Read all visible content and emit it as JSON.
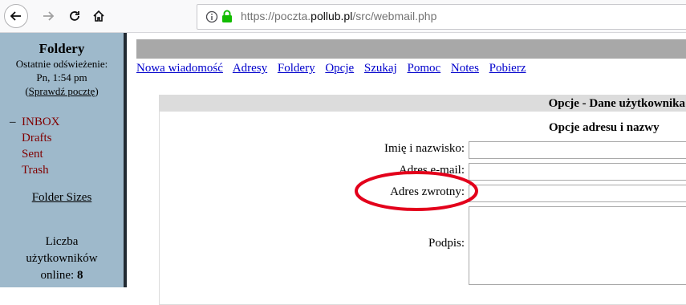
{
  "browser": {
    "url_prefix": "https://poczta.",
    "url_host": "pollub.pl",
    "url_path": "/src/webmail.php",
    "icons": {
      "back": "back-arrow-icon",
      "forward": "forward-arrow-icon",
      "reload": "reload-icon",
      "home": "home-icon",
      "info": "info-icon",
      "lock": "lock-icon"
    },
    "lock_color": "#12bc00"
  },
  "sidebar": {
    "title": "Foldery",
    "refresh_label": "Ostatnie odświeżenie:",
    "refresh_time": "Pn, 1:54 pm",
    "check_mail_open": "(",
    "check_mail": "Sprawdź pocztę",
    "check_mail_close": ")",
    "folders": [
      {
        "label": "INBOX",
        "current": true
      },
      {
        "label": "Drafts",
        "current": false
      },
      {
        "label": "Sent",
        "current": false
      },
      {
        "label": "Trash",
        "current": false
      }
    ],
    "current_marker": "–",
    "folder_sizes": "Folder Sizes",
    "online_line1": "Liczba",
    "online_line2": "użytkowników",
    "online_line3": "online:",
    "online_count": "8",
    "background_color": "#9eb9cb",
    "folder_link_color": "#800000"
  },
  "menu": [
    "Nowa wiadomość",
    "Adresy",
    "Foldery",
    "Opcje",
    "Szukaj",
    "Pomoc",
    "Notes",
    "Pobierz"
  ],
  "options": {
    "header": "Opcje - Dane użytkownika",
    "section_title": "Opcje adresu i nazwy",
    "fields": {
      "full_name": {
        "label": "Imię i nazwisko:",
        "value": ""
      },
      "email": {
        "label": "Adres e-mail:",
        "value": ""
      },
      "reply_to": {
        "label": "Adres zwrotny:",
        "value": ""
      },
      "signature": {
        "label": "Podpis:",
        "value": ""
      }
    },
    "highlight_color": "#e3001b"
  }
}
